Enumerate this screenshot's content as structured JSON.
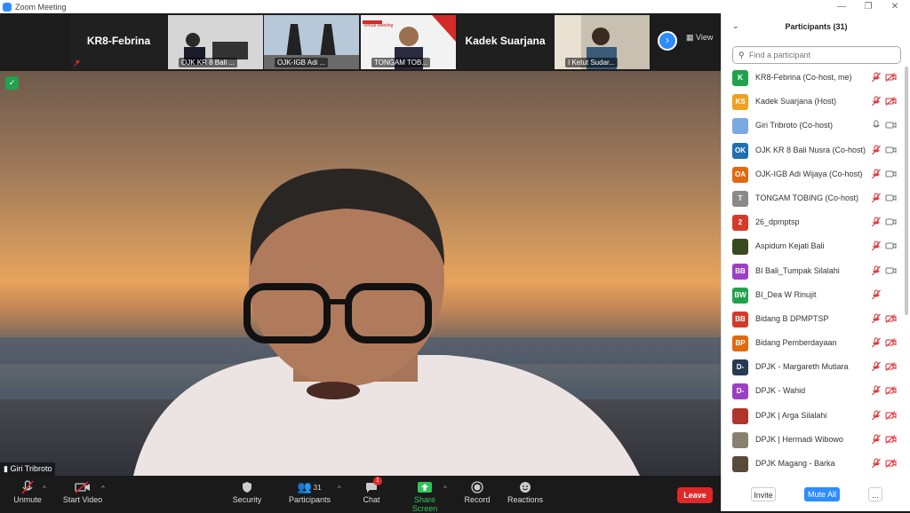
{
  "window": {
    "title": "Zoom Meeting",
    "controls": [
      "—",
      "❐",
      "✕"
    ]
  },
  "gallery": {
    "view_label": "View",
    "tiles": [
      {
        "name": "KR8-Febrina",
        "label": ""
      },
      {
        "name": "",
        "label": "OJK KR 8 Bali ..."
      },
      {
        "name": "",
        "label": "OJK-IGB Adi ..."
      },
      {
        "name": "",
        "label": "TONGAM TOB..."
      },
      {
        "name": "Kadek Suarjana",
        "label": ""
      },
      {
        "name": "",
        "label": "I Ketut Sudar..."
      }
    ],
    "virtual_meeting_text": "Virtual Meeting",
    "next": "›"
  },
  "main": {
    "speaker_name": "Giri Tribroto"
  },
  "toolbar": {
    "unmute": "Unmute",
    "start_video": "Start Video",
    "security": "Security",
    "participants": "Participants",
    "participants_count": "31",
    "chat": "Chat",
    "chat_badge": "1",
    "share_screen": "Share Screen",
    "record": "Record",
    "reactions": "Reactions",
    "leave": "Leave"
  },
  "panel": {
    "title": "Participants (31)",
    "search_placeholder": "Find a participant",
    "participants": [
      {
        "initials": "K",
        "color": "#23a24d",
        "name": "KR8-Febrina (Co-host, me)",
        "mic": "off",
        "cam": "off"
      },
      {
        "initials": "KS",
        "color": "#f0a020",
        "name": "Kadek Suarjana (Host)",
        "mic": "off",
        "cam": "off"
      },
      {
        "initials": "",
        "color": "#7aa8e0",
        "name": "Giri Tribroto (Co-host)",
        "mic": "on",
        "cam": "on"
      },
      {
        "initials": "OK",
        "color": "#1f6fb2",
        "name": "OJK KR 8 Bali Nusra (Co-host)",
        "mic": "off",
        "cam": "on"
      },
      {
        "initials": "OA",
        "color": "#e06a10",
        "name": "OJK-IGB Adi Wijaya (Co-host)",
        "mic": "off",
        "cam": "on"
      },
      {
        "initials": "T",
        "color": "#8a8a8a",
        "name": "TONGAM TOBING (Co-host)",
        "mic": "off",
        "cam": "on"
      },
      {
        "initials": "2",
        "color": "#d43a2a",
        "name": "26_dpmptsp",
        "mic": "off",
        "cam": "on"
      },
      {
        "initials": "",
        "color": "#3a4a20",
        "name": "Aspidum Kejati Bali",
        "mic": "off",
        "cam": "on"
      },
      {
        "initials": "BB",
        "color": "#9b3fc4",
        "name": "BI Bali_Tumpak Silalahi",
        "mic": "off",
        "cam": "on"
      },
      {
        "initials": "BW",
        "color": "#23a24d",
        "name": "BI_Dea W Rinujit",
        "mic": "off",
        "cam": "none"
      },
      {
        "initials": "BB",
        "color": "#d43a2a",
        "name": "Bidang B DPMPTSP",
        "mic": "off",
        "cam": "off"
      },
      {
        "initials": "BP",
        "color": "#e06a10",
        "name": "Bidang Pemberdayaan",
        "mic": "off",
        "cam": "off"
      },
      {
        "initials": "D-",
        "color": "#263a52",
        "name": "DPJK - Margareth Mutiara",
        "mic": "off",
        "cam": "off"
      },
      {
        "initials": "D-",
        "color": "#9b3fc4",
        "name": "DPJK - Wahid",
        "mic": "off",
        "cam": "off"
      },
      {
        "initials": "",
        "color": "#b0352a",
        "name": "DPJK | Arga Silalahi",
        "mic": "off",
        "cam": "off"
      },
      {
        "initials": "",
        "color": "#8a8070",
        "name": "DPJK | Hermadi Wibowo",
        "mic": "off",
        "cam": "off"
      },
      {
        "initials": "",
        "color": "#5a4a3a",
        "name": "DPJK Magang - Barka",
        "mic": "off",
        "cam": "off"
      }
    ],
    "invite": "Invite",
    "mute_all": "Mute All",
    "more": "..."
  }
}
